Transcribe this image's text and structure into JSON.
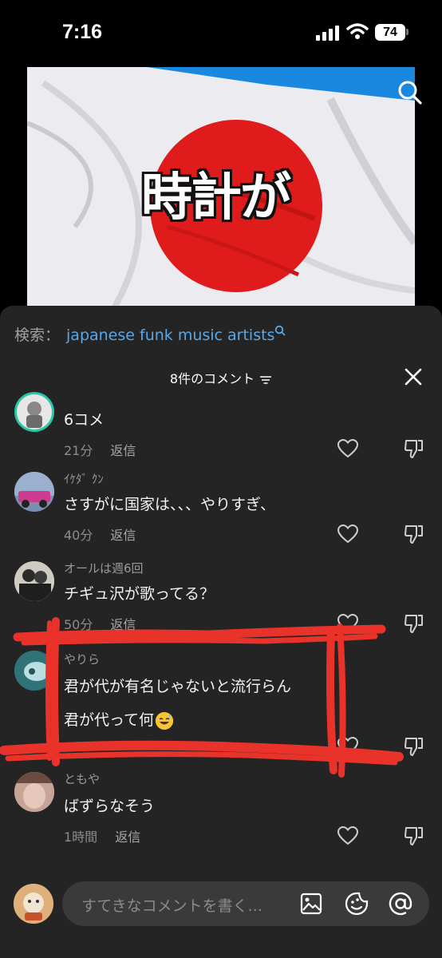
{
  "status": {
    "time": "7:16",
    "battery": "74"
  },
  "video": {
    "caption": "時計が"
  },
  "search_hint": {
    "label": "検索：",
    "term": "japanese funk music artists"
  },
  "comments_header": {
    "title": "8件のコメント"
  },
  "comments": [
    {
      "user": "",
      "text": "6コメ",
      "time": "21分",
      "reply": "返信"
    },
    {
      "user": "ｲｹﾀﾞ ｸﾝ",
      "text": "さすがに国家は、、、やりすぎ、",
      "time": "40分",
      "reply": "返信"
    },
    {
      "user": "オールは週6回",
      "text": "チギュ沢が歌ってる？",
      "time": "50分",
      "reply": "返信"
    },
    {
      "user": "やりら",
      "text": "君が代が有名じゃないと流行らん",
      "text2": "君が代って何",
      "time": "",
      "reply": ""
    },
    {
      "user": "ともや",
      "text": "ばずらなそう",
      "time": "1時間",
      "reply": "返信"
    }
  ],
  "input": {
    "placeholder": "すてきなコメントを書く..."
  },
  "icons": {
    "search": "search-icon",
    "close": "close-icon",
    "sort": "sort-icon",
    "like": "heart-icon",
    "dislike": "thumbs-down-icon",
    "image": "image-icon",
    "sticker": "sticker-icon",
    "mention": "at-icon"
  },
  "colors": {
    "sheet": "#242424",
    "link": "#5aa7e8",
    "annotation": "#e8322a",
    "flag_red": "#e01b1b"
  }
}
